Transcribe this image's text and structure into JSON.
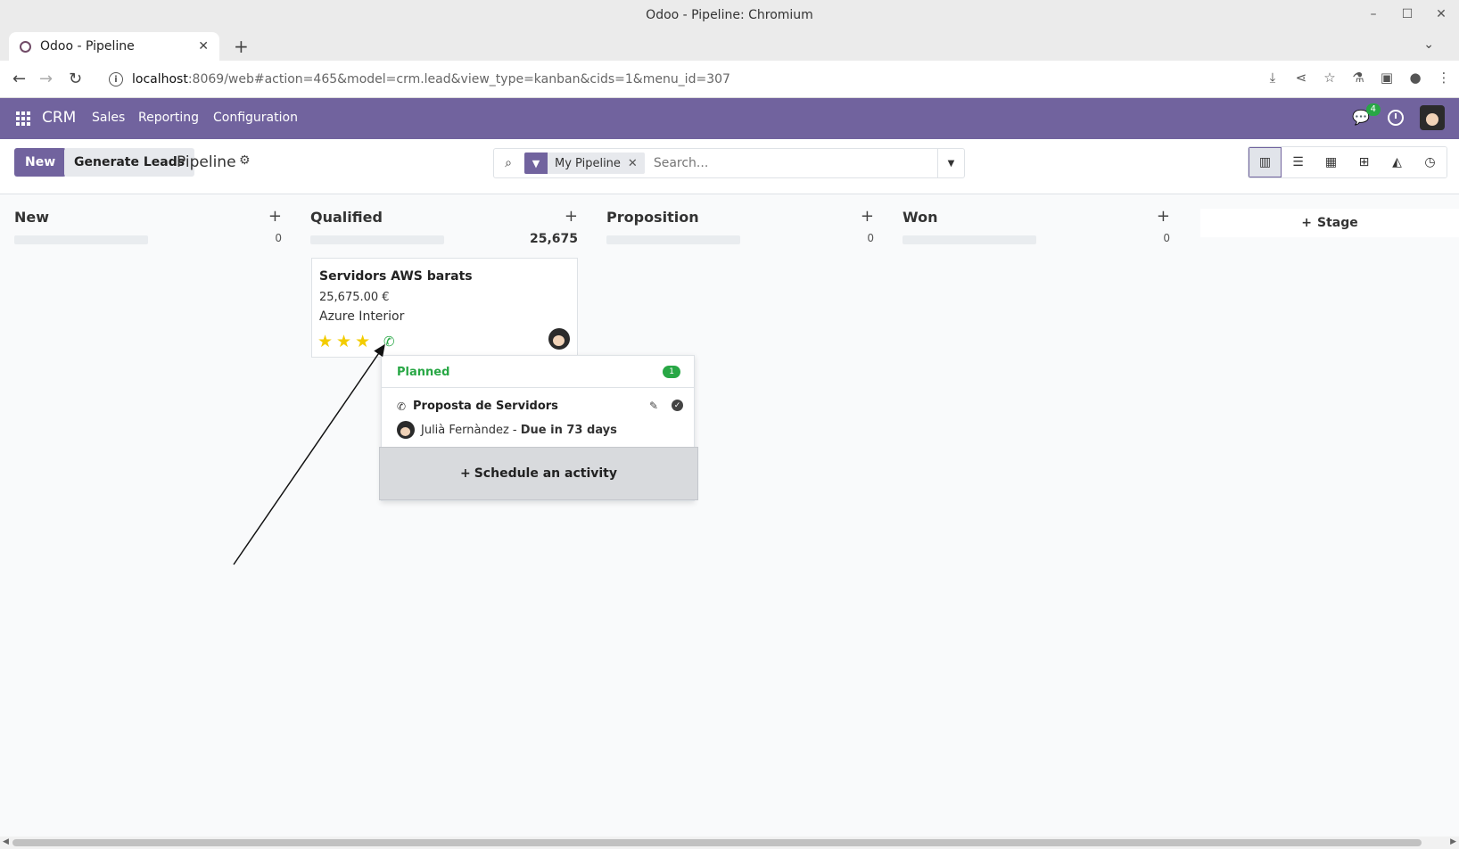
{
  "window": {
    "title": "Odoo - Pipeline: Chromium"
  },
  "browser": {
    "tab_title": "Odoo - Pipeline",
    "url_host": "localhost",
    "url_path": ":8069/web#action=465&model=crm.lead&view_type=kanban&cids=1&menu_id=307"
  },
  "navbar": {
    "brand": "CRM",
    "menu": [
      "Sales",
      "Reporting",
      "Configuration"
    ],
    "messages_count": "4"
  },
  "control": {
    "new_label": "New",
    "generate_label": "Generate Leads",
    "breadcrumb": "Pipeline",
    "facet_label": "My Pipeline",
    "search_placeholder": "Search..."
  },
  "columns": [
    {
      "title": "New",
      "count": "0"
    },
    {
      "title": "Qualified",
      "count": "25,675"
    },
    {
      "title": "Proposition",
      "count": "0"
    },
    {
      "title": "Won",
      "count": "0"
    }
  ],
  "add_stage_label": "Stage",
  "card": {
    "title": "Servidors AWS barats",
    "amount": "25,675.00 €",
    "company": "Azure Interior",
    "priority_stars": 3
  },
  "popover": {
    "header": "Planned",
    "count": "1",
    "activity_title": "Proposta de Servidors",
    "user": "Julià Fernàndez",
    "due": "Due in 73 days",
    "schedule_label": "Schedule an activity"
  },
  "colors": {
    "brand": "#71639e",
    "success": "#28a745",
    "star": "#f3cc00"
  }
}
